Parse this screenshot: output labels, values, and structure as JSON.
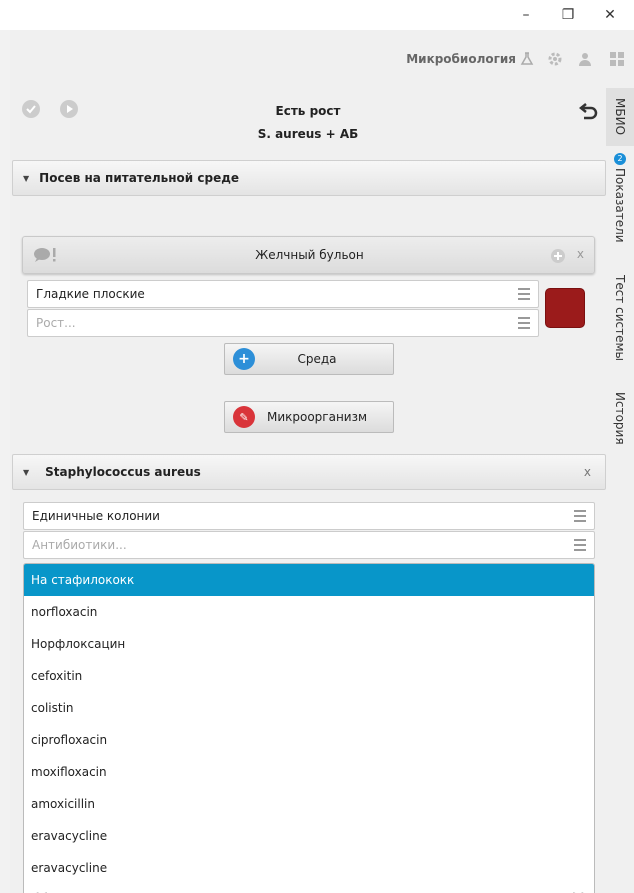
{
  "window": {
    "minimize": "–",
    "maximize": "❐",
    "close": "✕"
  },
  "topbar": {
    "app_name": "Микробиология"
  },
  "side_tabs": [
    {
      "label": "МБИО",
      "active": true
    },
    {
      "label": "Показатели",
      "badge": "2"
    },
    {
      "label": "Тест системы"
    },
    {
      "label": "История"
    }
  ],
  "header": {
    "title": "Есть рост",
    "subtitle": "S. aureus + АБ"
  },
  "sowing": {
    "section_label": "Посев на питательной среде",
    "medium_title": "Желчный бульон",
    "close": "x",
    "field1_value": "Гладкие плоские",
    "field2_placeholder": "Рост...",
    "swatch_color": "#9b1b1b",
    "env_button": "Среда",
    "microbe_button": "Микроорганизм"
  },
  "organism": {
    "section_label": "Staphylococcus aureus",
    "close": "x",
    "colonies_value": "Единичные колонии",
    "antibiotics_placeholder": "Антибиотики..."
  },
  "dropdown": {
    "items": [
      "На стафилококк",
      "norfloxacin",
      "Норфлоксацин",
      "cefoxitin",
      "colistin",
      "ciprofloxacin",
      "moxifloxacin",
      "amoxicillin",
      "eravacycline",
      "eravacycline"
    ],
    "prev": "<<",
    "next": ">>"
  }
}
